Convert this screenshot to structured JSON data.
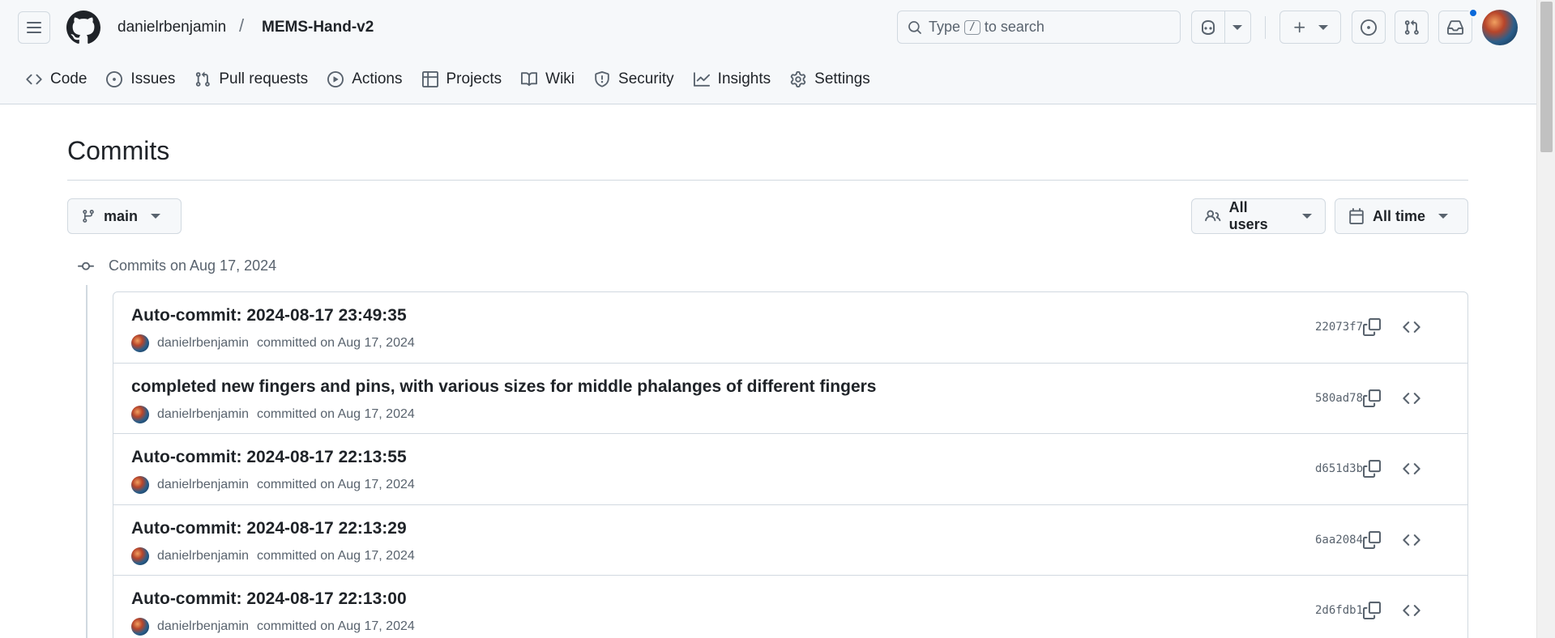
{
  "header": {
    "owner": "danielrbenjamin",
    "separator": "/",
    "repo": "MEMS-Hand-v2",
    "search": {
      "prefix": "Type",
      "key": "/",
      "suffix": "to search"
    }
  },
  "repo_nav": [
    {
      "label": "Code",
      "icon": "code-icon"
    },
    {
      "label": "Issues",
      "icon": "issue-icon"
    },
    {
      "label": "Pull requests",
      "icon": "pull-request-icon"
    },
    {
      "label": "Actions",
      "icon": "play-icon"
    },
    {
      "label": "Projects",
      "icon": "table-icon"
    },
    {
      "label": "Wiki",
      "icon": "book-icon"
    },
    {
      "label": "Security",
      "icon": "shield-icon"
    },
    {
      "label": "Insights",
      "icon": "graph-icon"
    },
    {
      "label": "Settings",
      "icon": "gear-icon"
    }
  ],
  "page": {
    "title": "Commits",
    "branch": "main",
    "users_filter": "All users",
    "time_filter": "All time",
    "group_label": "Commits on Aug 17, 2024"
  },
  "commits": [
    {
      "title": "Auto-commit: 2024-08-17 23:49:35",
      "author": "danielrbenjamin",
      "meta": "committed on Aug 17, 2024",
      "sha": "22073f7"
    },
    {
      "title": "completed new fingers and pins, with various sizes for middle phalanges of different fingers",
      "author": "danielrbenjamin",
      "meta": "committed on Aug 17, 2024",
      "sha": "580ad78"
    },
    {
      "title": "Auto-commit: 2024-08-17 22:13:55",
      "author": "danielrbenjamin",
      "meta": "committed on Aug 17, 2024",
      "sha": "d651d3b"
    },
    {
      "title": "Auto-commit: 2024-08-17 22:13:29",
      "author": "danielrbenjamin",
      "meta": "committed on Aug 17, 2024",
      "sha": "6aa2084"
    },
    {
      "title": "Auto-commit: 2024-08-17 22:13:00",
      "author": "danielrbenjamin",
      "meta": "committed on Aug 17, 2024",
      "sha": "2d6fdb1"
    }
  ],
  "colors": {
    "accent": "#0969da",
    "border": "#d1d9e0",
    "muted": "#59636e",
    "header_bg": "#f6f8fa"
  }
}
